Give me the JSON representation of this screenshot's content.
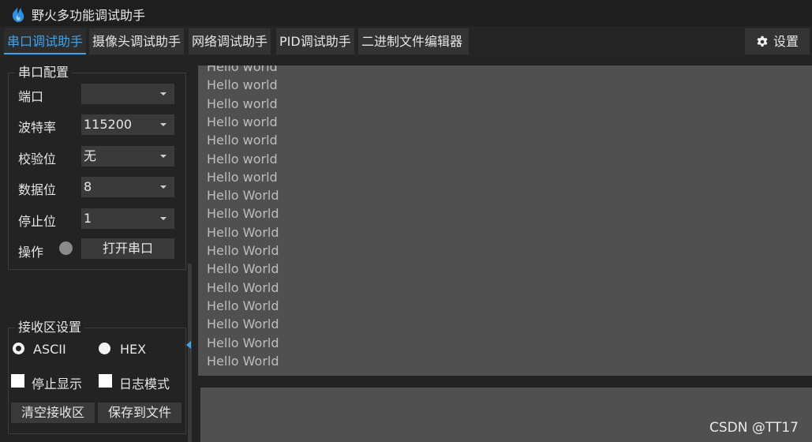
{
  "app": {
    "title": "野火多功能调试助手",
    "accent": "#3ea2ec"
  },
  "tabs": [
    {
      "label": "串口调试助手"
    },
    {
      "label": "摄像头调试助手"
    },
    {
      "label": "网络调试助手"
    },
    {
      "label": "PID调试助手"
    },
    {
      "label": "二进制文件编辑器"
    }
  ],
  "settings": {
    "label": "设置",
    "icon": "gear-icon"
  },
  "serial_config": {
    "title": "串口配置",
    "port": {
      "label": "端口",
      "value": ""
    },
    "baud": {
      "label": "波特率",
      "value": "115200"
    },
    "parity": {
      "label": "校验位",
      "value": "无"
    },
    "databits": {
      "label": "数据位",
      "value": "8"
    },
    "stopbits": {
      "label": "停止位",
      "value": "1"
    },
    "operation": {
      "label": "操作",
      "button": "打开串口"
    }
  },
  "recv_config": {
    "title": "接收区设置",
    "ascii": "ASCII",
    "hex": "HEX",
    "stop_display": "停止显示",
    "log_mode": "日志模式",
    "clear_button": "清空接收区",
    "save_button": "保存到文件"
  },
  "receive_area": {
    "lines": [
      "Hello world",
      "Hello world",
      "Hello world",
      "Hello world",
      "Hello world",
      "Hello world",
      "Hello world",
      "Hello World",
      "Hello World",
      "Hello World",
      "Hello World",
      "Hello World",
      "Hello World",
      "Hello World",
      "Hello World",
      "Hello World",
      "Hello World"
    ]
  },
  "watermark": "CSDN @TT17"
}
